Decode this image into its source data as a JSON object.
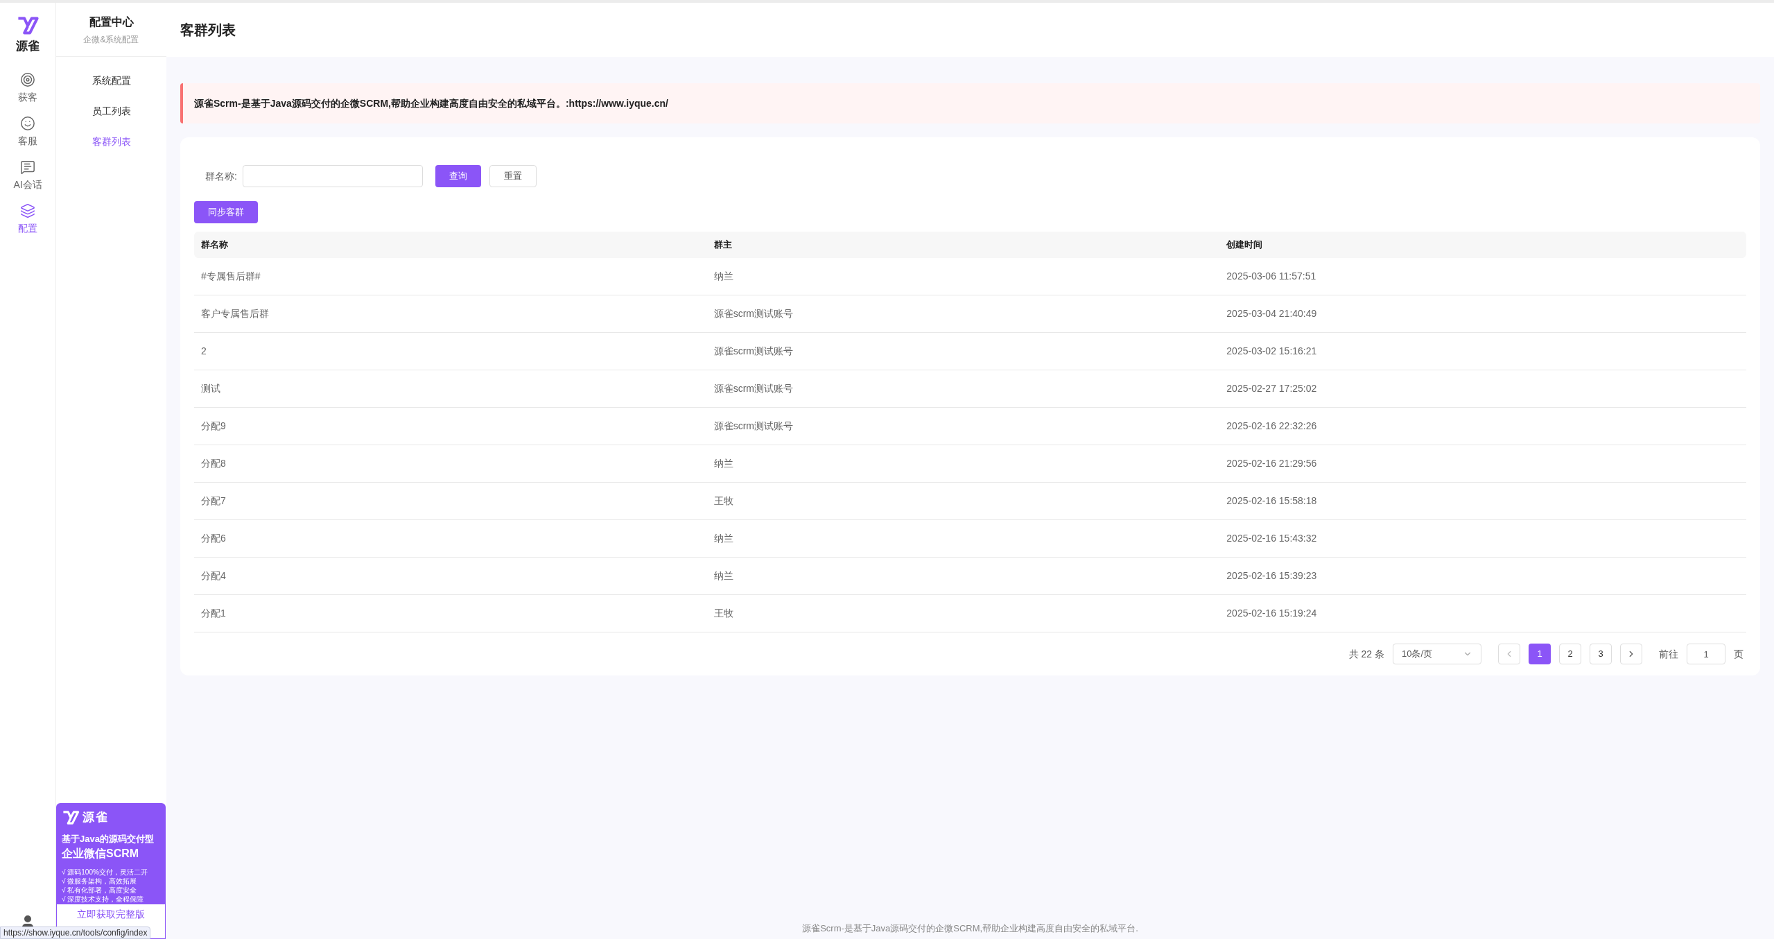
{
  "rail": {
    "brand": "源雀",
    "items": [
      {
        "label": "获客",
        "selected": false
      },
      {
        "label": "客服",
        "selected": false
      },
      {
        "label": "AI会话",
        "selected": false
      },
      {
        "label": "配置",
        "selected": true
      }
    ]
  },
  "submenu": {
    "title": "配置中心",
    "subtitle": "企微&系统配置",
    "items": [
      {
        "label": "系统配置",
        "selected": false
      },
      {
        "label": "员工列表",
        "selected": false
      },
      {
        "label": "客群列表",
        "selected": true
      }
    ]
  },
  "promo": {
    "brand": "源雀",
    "line1": "基于Java的源码交付型",
    "line2": "企业微信SCRM",
    "bullets": [
      "√ 源码100%交付，灵活二开",
      "√ 微服务架构，高效拓展",
      "√ 私有化部署，高度安全",
      "√ 深度技术支持，全程保障"
    ],
    "cta": "立即获取完整版"
  },
  "status_url": "https://show.iyque.cn/tools/config/index",
  "page_title": "客群列表",
  "notice": "源雀Scrm-是基于Java源码交付的企微SCRM,帮助企业构建高度自由安全的私域平台。:https://www.iyque.cn/",
  "filter": {
    "label": "群名称:",
    "query": "查询",
    "reset": "重置",
    "sync": "同步客群"
  },
  "table": {
    "columns": [
      "群名称",
      "群主",
      "创建时间"
    ],
    "rows": [
      [
        "#专属售后群#",
        "纳兰",
        "2025-03-06 11:57:51"
      ],
      [
        "客户专属售后群",
        "源雀scrm测试账号",
        "2025-03-04 21:40:49"
      ],
      [
        "2",
        "源雀scrm测试账号",
        "2025-03-02 15:16:21"
      ],
      [
        "测试",
        "源雀scrm测试账号",
        "2025-02-27 17:25:02"
      ],
      [
        "分配9",
        "源雀scrm测试账号",
        "2025-02-16 22:32:26"
      ],
      [
        "分配8",
        "纳兰",
        "2025-02-16 21:29:56"
      ],
      [
        "分配7",
        "王牧",
        "2025-02-16 15:58:18"
      ],
      [
        "分配6",
        "纳兰",
        "2025-02-16 15:43:32"
      ],
      [
        "分配4",
        "纳兰",
        "2025-02-16 15:39:23"
      ],
      [
        "分配1",
        "王牧",
        "2025-02-16 15:19:24"
      ]
    ]
  },
  "pagination": {
    "total": "共 22 条",
    "page_size": "10条/页",
    "pages": [
      {
        "label": "1",
        "selected": true
      },
      {
        "label": "2",
        "selected": false
      },
      {
        "label": "3",
        "selected": false
      }
    ],
    "goto_label": "前往",
    "goto_value": "1",
    "goto_suffix": "页"
  },
  "footer": "源雀Scrm-是基于Java源码交付的企微SCRM,帮助企业构建高度自由安全的私域平台."
}
